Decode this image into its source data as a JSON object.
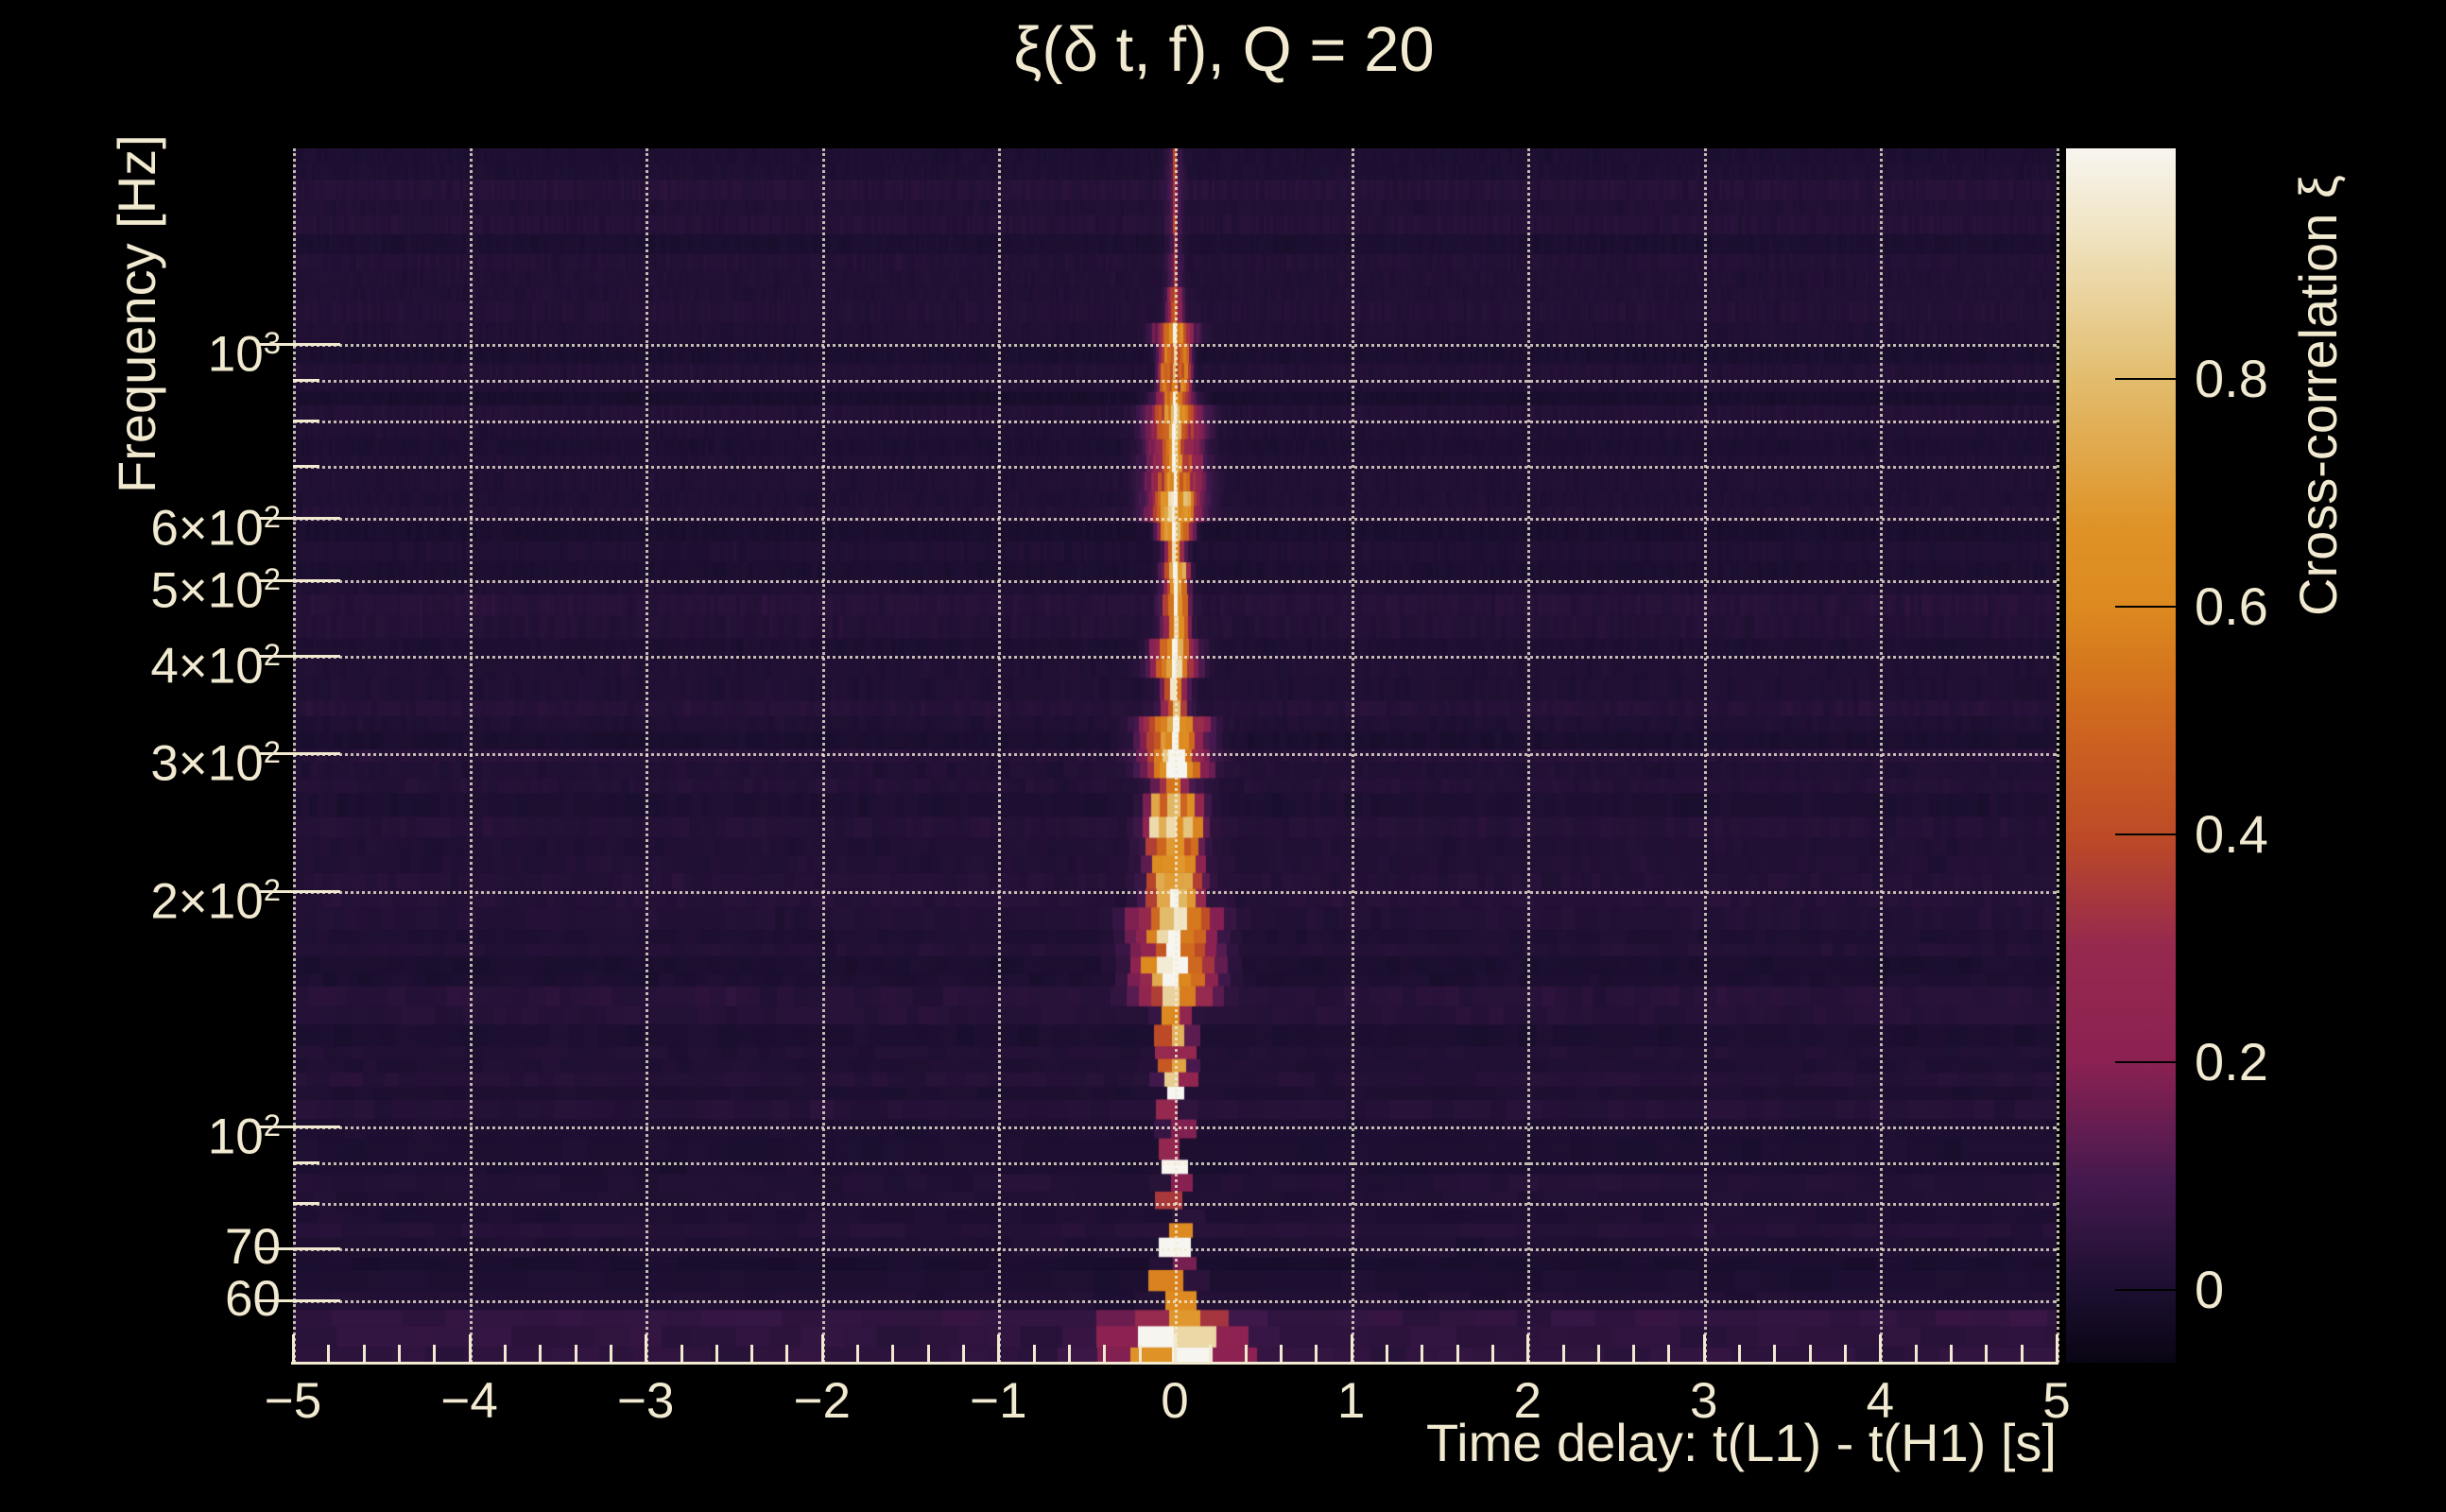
{
  "title": "ξ(δ t, f), Q = 20",
  "colors": {
    "background": "#000000",
    "text_cream": "#f1ead1",
    "gridline": "rgba(242,235,212,0.78)",
    "colorbar_tick": "#000000"
  },
  "chart_data": {
    "type": "heatmap",
    "title": "ξ(δ t, f), Q = 20",
    "q_value": 20,
    "xlabel": "Time delay: t(L1) - t(H1) [s]",
    "ylabel": "Frequency [Hz]",
    "colorbar_title": "Cross-correlation ξ",
    "x_range_s": [
      -5,
      5
    ],
    "y_range_hz": [
      50,
      1780
    ],
    "y_scale": "log",
    "grid": "dotted",
    "color_range_xi": [
      -0.064,
      1.003
    ],
    "x_ticks": [
      {
        "t": -5,
        "label": "−5"
      },
      {
        "t": -4,
        "label": "−4"
      },
      {
        "t": -3,
        "label": "−3"
      },
      {
        "t": -2,
        "label": "−2"
      },
      {
        "t": -1,
        "label": "−1"
      },
      {
        "t": 0,
        "label": "0"
      },
      {
        "t": 1,
        "label": "1"
      },
      {
        "t": 2,
        "label": "2"
      },
      {
        "t": 3,
        "label": "3"
      },
      {
        "t": 4,
        "label": "4"
      },
      {
        "t": 5,
        "label": "5"
      }
    ],
    "x_minor_step_s": 0.2,
    "y_ticks_labeled": [
      {
        "f": 1000,
        "base": "10",
        "sup": "3"
      },
      {
        "f": 600,
        "base": "6×10",
        "sup": "2"
      },
      {
        "f": 500,
        "base": "5×10",
        "sup": "2"
      },
      {
        "f": 400,
        "base": "4×10",
        "sup": "2"
      },
      {
        "f": 300,
        "base": "3×10",
        "sup": "2"
      },
      {
        "f": 200,
        "base": "2×10",
        "sup": "2"
      },
      {
        "f": 100,
        "base": "10",
        "sup": "2"
      },
      {
        "f": 70,
        "base": "70",
        "sup": ""
      },
      {
        "f": 60,
        "base": "60",
        "sup": ""
      }
    ],
    "y_gridlines_unlabeled_hz": [
      80,
      90,
      700,
      800,
      900
    ],
    "colorbar_ticks": [
      {
        "v": 0.8,
        "label": "0.8"
      },
      {
        "v": 0.6,
        "label": "0.6"
      },
      {
        "v": 0.4,
        "label": "0.4"
      },
      {
        "v": 0.2,
        "label": "0.2"
      },
      {
        "v": 0.0,
        "label": "0"
      }
    ],
    "colormap_stops": [
      {
        "frac": 0.0,
        "hex": "#0a0514"
      },
      {
        "frac": 0.061,
        "hex": "#1c0f30"
      },
      {
        "frac": 0.149,
        "hex": "#44194e"
      },
      {
        "frac": 0.247,
        "hex": "#8b2152"
      },
      {
        "frac": 0.344,
        "hex": "#96294e"
      },
      {
        "frac": 0.433,
        "hex": "#bd4a26"
      },
      {
        "frac": 0.538,
        "hex": "#d06a1e"
      },
      {
        "frac": 0.622,
        "hex": "#dc8a1f"
      },
      {
        "frac": 0.686,
        "hex": "#df9226"
      },
      {
        "frac": 0.811,
        "hex": "#e2bd6e"
      },
      {
        "frac": 0.928,
        "hex": "#f0e3c0"
      },
      {
        "frac": 1.0,
        "hex": "#f7f5ef"
      }
    ],
    "features": {
      "description": "Cross-correlation concentrated in a narrow vertical ridge at time delay ≈ 0 s spanning all frequencies; brightest (ξ≈1) near 50–60 Hz, orange halo blobs through 100–1000 Hz, ring-shaped structure near 950 Hz, faint above 1100 Hz. Background is low-amplitude noise (ξ≈0).",
      "noise_xi_mean": 0.02,
      "core_components": [
        {
          "f": [
            50,
            1060
          ],
          "xi": 0.55,
          "hw": 0.007
        },
        {
          "f": [
            50,
            1060
          ],
          "xi": 0.18,
          "hw": 0.03
        },
        {
          "f": [
            1060,
            1780
          ],
          "xi": 0.26,
          "hw": 0.006
        }
      ],
      "ridge_bands": [
        {
          "f": [
            50,
            57
          ],
          "xi": 0.9,
          "hw": 0.09
        },
        {
          "f": [
            50,
            60
          ],
          "xi": 0.45,
          "hw": 0.22
        },
        {
          "f": [
            57,
            66
          ],
          "xi": 0.8,
          "hw": 0.05
        },
        {
          "f": [
            66,
            80
          ],
          "xi": 0.72,
          "hw": 0.03
        },
        {
          "f": [
            80,
            95
          ],
          "xi": 0.62,
          "hw": 0.022
        },
        {
          "f": [
            95,
            115
          ],
          "xi": 0.7,
          "hw": 0.028
        },
        {
          "f": [
            115,
            145
          ],
          "xi": 0.66,
          "hw": 0.05
        },
        {
          "f": [
            145,
            190
          ],
          "xi": 0.75,
          "hw": 0.13
        },
        {
          "f": [
            190,
            260
          ],
          "xi": 0.58,
          "hw": 0.09
        },
        {
          "f": [
            190,
            260
          ],
          "xi": 0.4,
          "hw": 0.03,
          "c": -0.1
        },
        {
          "f": [
            190,
            260
          ],
          "xi": 0.4,
          "hw": 0.03,
          "c": 0.1
        },
        {
          "f": [
            260,
            300
          ],
          "xi": 0.42,
          "hw": 0.07
        },
        {
          "f": [
            280,
            330
          ],
          "xi": 0.6,
          "hw": 0.11
        },
        {
          "f": [
            330,
            385
          ],
          "xi": 0.5,
          "hw": 0.045
        },
        {
          "f": [
            385,
            430
          ],
          "xi": 0.65,
          "hw": 0.075
        },
        {
          "f": [
            430,
            520
          ],
          "xi": 0.5,
          "hw": 0.045
        },
        {
          "f": [
            430,
            520
          ],
          "xi": 0.33,
          "hw": 0.02,
          "c": 0.05
        },
        {
          "f": [
            520,
            580
          ],
          "xi": 0.45,
          "hw": 0.035
        },
        {
          "f": [
            580,
            690
          ],
          "xi": 0.5,
          "hw": 0.1
        },
        {
          "f": [
            560,
            660
          ],
          "xi": 0.33,
          "hw": 0.03,
          "c": -0.065
        },
        {
          "f": [
            560,
            660
          ],
          "xi": 0.33,
          "hw": 0.03,
          "c": 0.065
        },
        {
          "f": [
            700,
            820
          ],
          "xi": 0.52,
          "hw": 0.095
        },
        {
          "f": [
            820,
            870
          ],
          "xi": 0.5,
          "hw": 0.07
        },
        {
          "f": [
            870,
            1000
          ],
          "xi": 0.5,
          "hw": 0.026,
          "c": -0.055
        },
        {
          "f": [
            870,
            1000
          ],
          "xi": 0.5,
          "hw": 0.026,
          "c": 0.055
        },
        {
          "f": [
            1000,
            1065
          ],
          "xi": 0.5,
          "hw": 0.07
        },
        {
          "f": [
            1065,
            1200
          ],
          "xi": 0.28,
          "hw": 0.03
        },
        {
          "f": [
            1200,
            1780
          ],
          "xi": 0.1,
          "hw": 0.03
        }
      ]
    }
  }
}
